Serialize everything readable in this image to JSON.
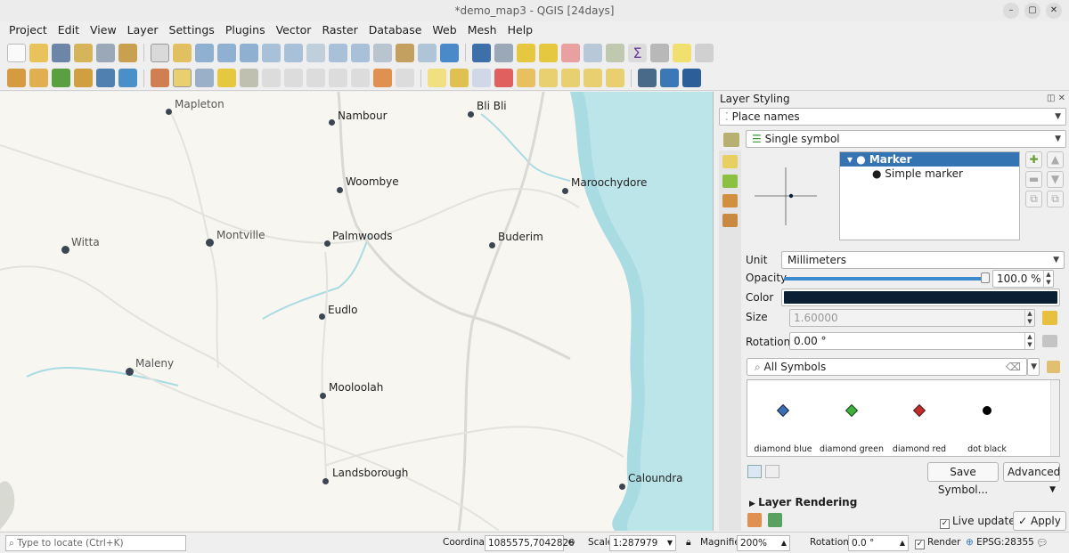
{
  "window": {
    "title": "*demo_map3 - QGIS [24days]",
    "controls": [
      "–",
      "▢",
      "✕"
    ]
  },
  "menu": [
    "Project",
    "Edit",
    "View",
    "Layer",
    "Settings",
    "Plugins",
    "Vector",
    "Raster",
    "Database",
    "Web",
    "Mesh",
    "Help"
  ],
  "map": {
    "places": [
      {
        "name": "Mapleton",
        "style": "sm"
      },
      {
        "name": "Nambour",
        "style": ""
      },
      {
        "name": "Bli Bli",
        "style": ""
      },
      {
        "name": "Woombye",
        "style": ""
      },
      {
        "name": "Maroochydore",
        "style": ""
      },
      {
        "name": "Witta",
        "style": "sm"
      },
      {
        "name": "Montville",
        "style": "sm"
      },
      {
        "name": "Palmwoods",
        "style": ""
      },
      {
        "name": "Buderim",
        "style": ""
      },
      {
        "name": "Eudlo",
        "style": ""
      },
      {
        "name": "Maleny",
        "style": "sm"
      },
      {
        "name": "Mooloolah",
        "style": ""
      },
      {
        "name": "Landsborough",
        "style": ""
      },
      {
        "name": "Caloundra",
        "style": ""
      }
    ],
    "colors": {
      "land": "#f7f6f1",
      "water": "#a9dbe3",
      "road": "#d9d9d6",
      "dot": "#3c4653"
    }
  },
  "panel": {
    "title": "Layer Styling",
    "layer": "Place names",
    "renderer": "Single symbol",
    "tree": {
      "root": "Marker",
      "child": "Simple marker"
    },
    "unit_label": "Unit",
    "unit_value": "Millimeters",
    "opacity_label": "Opacity",
    "opacity_value": "100.0 %",
    "opacity_level": 1.0,
    "color_label": "Color",
    "color_value": "#0a1f33",
    "size_label": "Size",
    "size_value": "1.60000",
    "rotation_label": "Rotation",
    "rotation_value": "0.00 °",
    "search_placeholder": "All Symbols",
    "symbols": [
      {
        "name": "diamond blue",
        "color": "#3b6fb5",
        "shape": "diamond"
      },
      {
        "name": "diamond green",
        "color": "#3fb23c",
        "shape": "diamond"
      },
      {
        "name": "diamond red",
        "color": "#c42b2b",
        "shape": "diamond"
      },
      {
        "name": "dot  black",
        "color": "#000000",
        "shape": "dot"
      }
    ],
    "save_symbol": "Save Symbol...",
    "advanced": "Advanced",
    "layer_rendering": "Layer Rendering",
    "live_update": "Live update",
    "apply": "Apply"
  },
  "status": {
    "locate_placeholder": "Type to locate (Ctrl+K)",
    "coordinate_label": "Coordinate",
    "coordinate_value": "1085575,7042826",
    "scale_label": "Scale",
    "scale_value": "1:287979",
    "magnifier_label": "Magnifier",
    "magnifier_value": "200%",
    "rotation_label": "Rotation",
    "rotation_value": "0.0 °",
    "render_label": "Render",
    "crs": "EPSG:28355"
  }
}
